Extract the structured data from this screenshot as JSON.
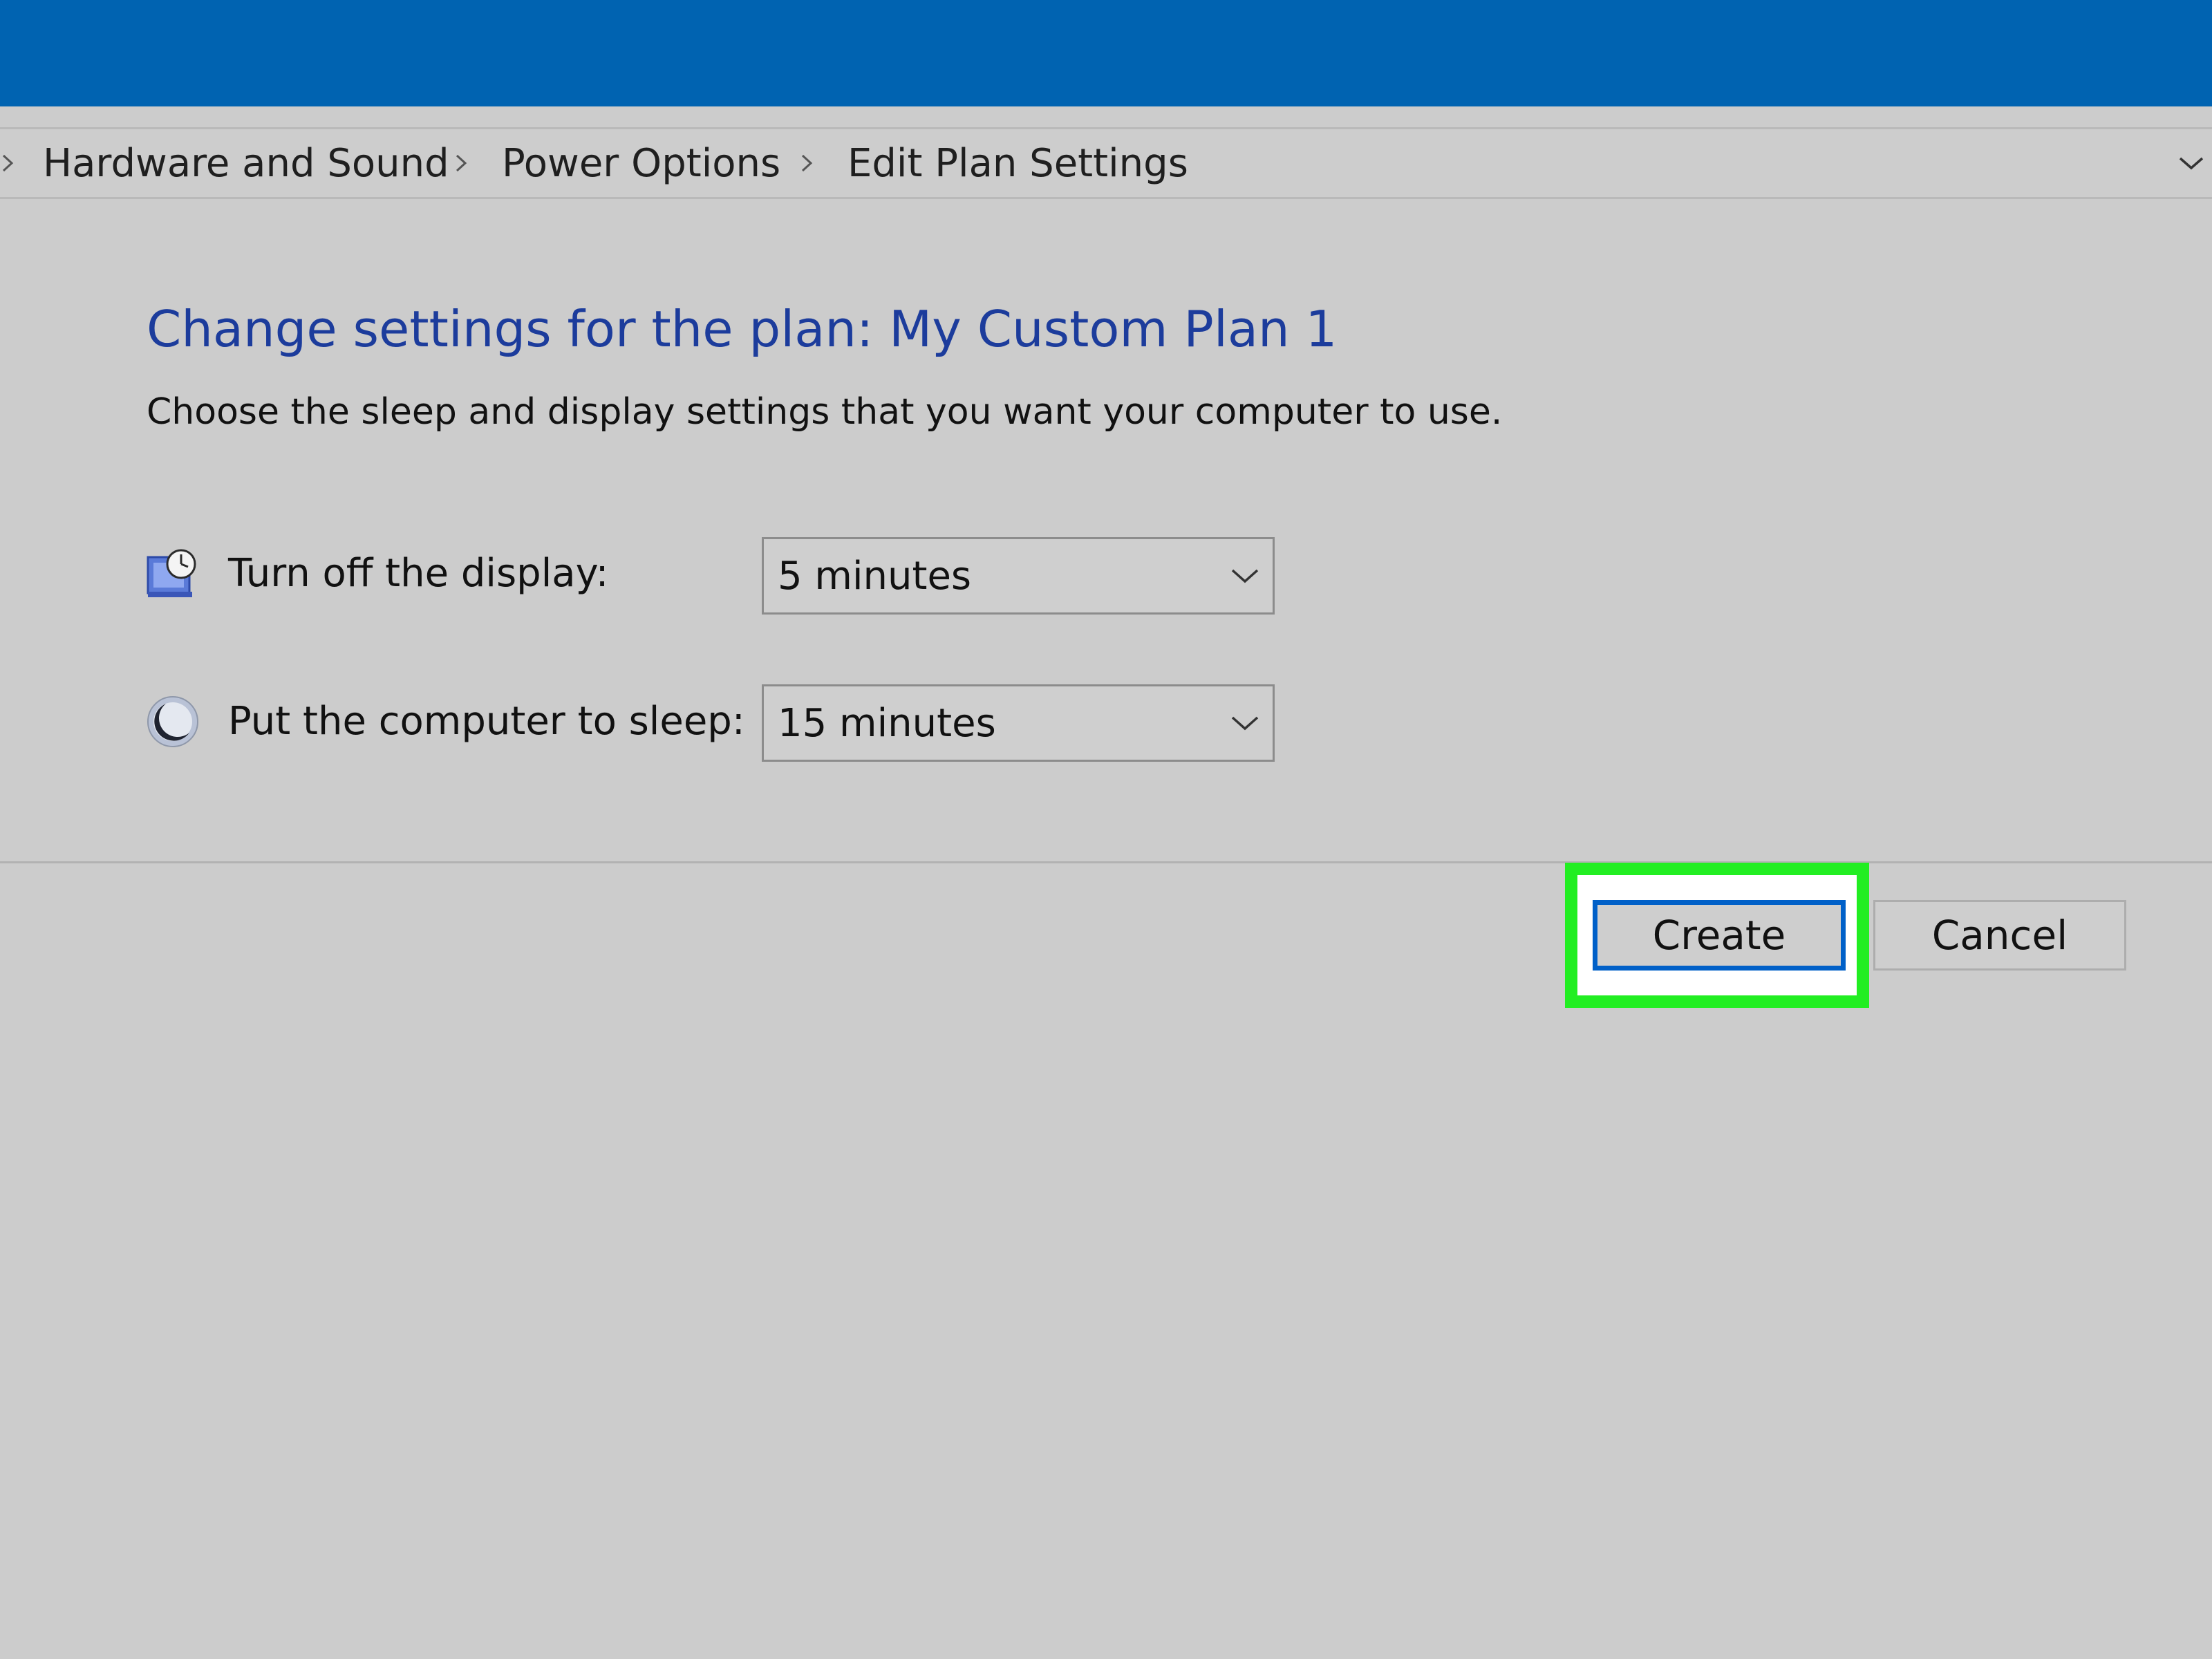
{
  "breadcrumb": {
    "items": [
      "Hardware and Sound",
      "Power Options",
      "Edit Plan Settings"
    ]
  },
  "main": {
    "title": "Change settings for the plan: My Custom Plan 1",
    "description": "Choose the sleep and display settings that you want your computer to use.",
    "settings": [
      {
        "label": "Turn off the display:",
        "value": "5 minutes",
        "icon": "display-timer-icon"
      },
      {
        "label": "Put the computer to sleep:",
        "value": "15 minutes",
        "icon": "sleep-moon-icon"
      }
    ]
  },
  "buttons": {
    "create_label": "Create",
    "cancel_label": "Cancel"
  },
  "colors": {
    "titlebar": "#0063b1",
    "title_text": "#1c3c9c",
    "highlight": "#22ee22",
    "default_button_border": "#0060c8"
  }
}
